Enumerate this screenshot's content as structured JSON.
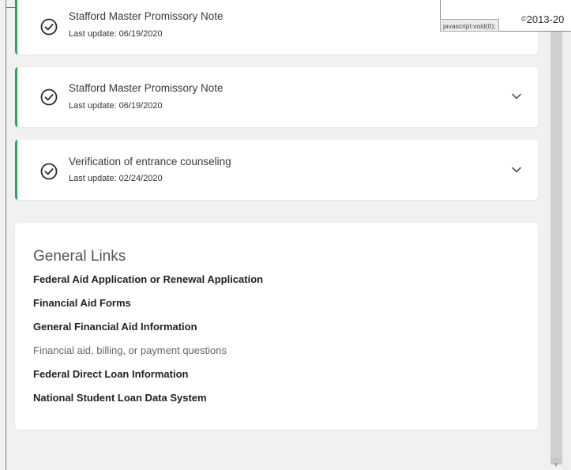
{
  "documents": [
    {
      "title": "Stafford Master Promissory Note",
      "updated": "Last update: 06/19/2020",
      "status_icon": "check-circle-icon"
    },
    {
      "title": "Stafford Master Promissory Note",
      "updated": "Last update: 06/19/2020",
      "status_icon": "check-circle-icon"
    },
    {
      "title": "Verification of entrance counseling",
      "updated": "Last update: 02/24/2020",
      "status_icon": "check-circle-icon"
    }
  ],
  "general_links": {
    "title": "General Links",
    "items": [
      {
        "label": "Federal Aid Application or Renewal Application"
      },
      {
        "label": "Financial Aid Forms"
      },
      {
        "label": "General Financial Aid Information"
      },
      {
        "label": "Financial aid, billing, or payment questions"
      },
      {
        "label": "Federal Direct Loan Information"
      },
      {
        "label": "National Student Loan Data System"
      }
    ]
  },
  "status_bar": {
    "url": "javascript:void(0);"
  },
  "footer": {
    "copyright_symbol": "©",
    "copyright_text": "2013-20"
  },
  "colors": {
    "accent": "#27a85a",
    "card": "#ffffff",
    "background": "#f1f1f1"
  }
}
